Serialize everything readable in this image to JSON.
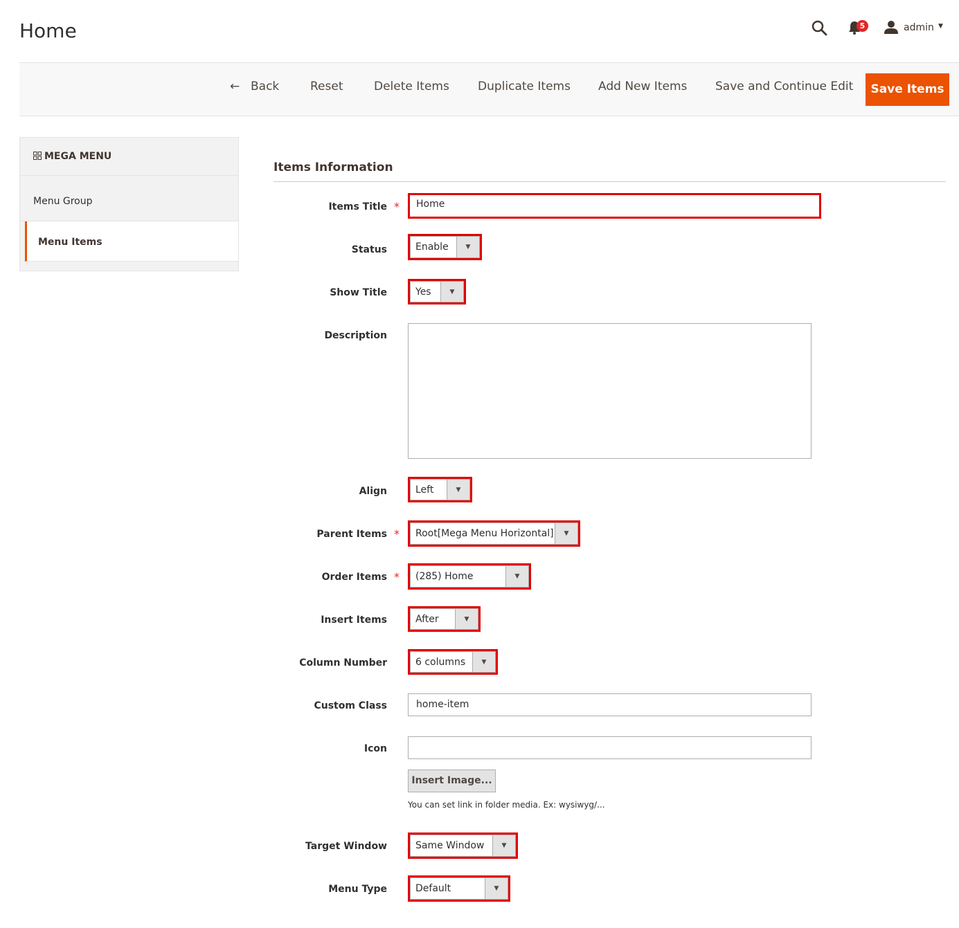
{
  "header": {
    "title": "Home",
    "notification_count": "5",
    "user": "admin",
    "icons": [
      "search-icon",
      "bell-icon",
      "user-icon"
    ]
  },
  "toolbar": {
    "back": "Back",
    "reset": "Reset",
    "delete": "Delete Items",
    "duplicate": "Duplicate Items",
    "add_new": "Add New Items",
    "save_continue": "Save and Continue Edit",
    "save": "Save Items"
  },
  "sidebar": {
    "heading": "MEGA MENU",
    "items": [
      {
        "label": "Menu Group"
      },
      {
        "label": "Menu Items"
      }
    ]
  },
  "form": {
    "section_title": "Items Information",
    "items_title": {
      "label": "Items Title",
      "value": "Home"
    },
    "status": {
      "label": "Status",
      "value": "Enable"
    },
    "show_title": {
      "label": "Show Title",
      "value": "Yes"
    },
    "description": {
      "label": "Description",
      "value": ""
    },
    "align": {
      "label": "Align",
      "value": "Left"
    },
    "parent_items": {
      "label": "Parent Items",
      "value": "Root[Mega Menu Horizontal]"
    },
    "order_items": {
      "label": "Order Items",
      "value": "(285) Home"
    },
    "insert_items": {
      "label": "Insert Items",
      "value": "After"
    },
    "column_number": {
      "label": "Column Number",
      "value": "6 columns"
    },
    "custom_class": {
      "label": "Custom Class",
      "value": "home-item"
    },
    "icon": {
      "label": "Icon",
      "value": "",
      "button": "Insert Image...",
      "note": "You can set link in folder media. Ex: wysiwyg/..."
    },
    "target_window": {
      "label": "Target Window",
      "value": "Same Window"
    },
    "menu_type": {
      "label": "Menu Type",
      "value": "Default"
    },
    "required_mark": "*"
  },
  "colors": {
    "accent": "#eb5202",
    "highlight": "#e10000",
    "badge": "#e22626"
  }
}
